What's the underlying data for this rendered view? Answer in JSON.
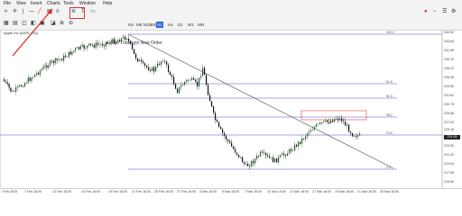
{
  "menu": [
    "File",
    "View",
    "Insert",
    "Charts",
    "Tools",
    "Window",
    "Help"
  ],
  "toolbar": {
    "algo_trading": "Algo Trading",
    "new_order": "New Order",
    "timeframes": [
      "M1",
      "M5",
      "M15",
      "M30",
      "H1",
      "H4",
      "D1",
      "W1",
      "MN"
    ],
    "active_timeframe": "H1"
  },
  "chart": {
    "symbol_label": "Apple Inc (AAPL.OQ)",
    "y_axis_labels": [
      "245.52",
      "243.84",
      "241.96",
      "240.10",
      "238.22",
      "236.36",
      "234.50",
      "232.62",
      "230.76",
      "228.88",
      "227.02",
      "225.16",
      "223.30",
      "221.42",
      "219.54",
      "217.68",
      "215.80"
    ],
    "fib_labels": [
      "100.0",
      "61.8",
      "50.0",
      "38.2",
      "23.6",
      "0.0"
    ],
    "x_axis_labels": [
      "7 Feb 2025",
      "7 Feb 16:00",
      "12 Feb 16:00",
      "14 Feb 16:00",
      "19 Feb 16:00",
      "21 Feb 16:00",
      "25 Feb 16:00",
      "27 Feb 16:00",
      "3 Mar 16:00",
      "5 Mar 16:00",
      "7 Mar 16:00",
      "11 Mar 16:00",
      "13 Mar 16:00",
      "17 Mar 16:00",
      "19 Mar 16:00",
      "21 Mar 16:00",
      "25 Mar 16:00"
    ],
    "current_price": "221.55",
    "colors": {
      "bull": "#2f5f2f",
      "bear": "#111111",
      "fib": "#4a4ad0",
      "zone": "#e04040",
      "trend": "#555555"
    }
  }
}
